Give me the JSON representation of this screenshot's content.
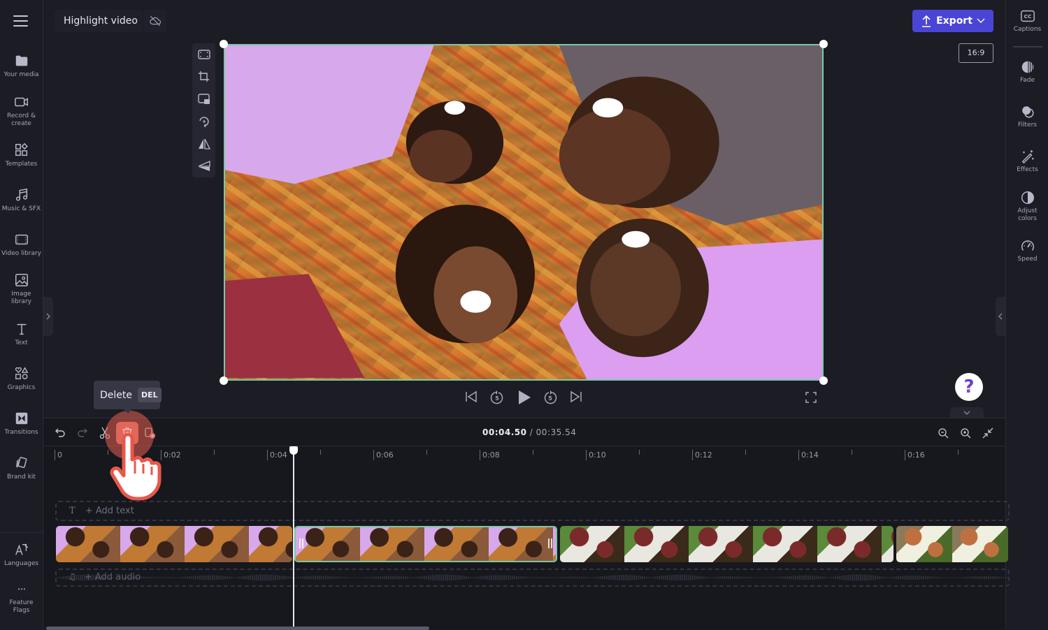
{
  "project": {
    "title": "Highlight video",
    "cloud_status_icon": "cloud-off-icon"
  },
  "left_rail": {
    "menu_icon": "hamburger-menu-icon",
    "items": [
      {
        "label": "Your media",
        "icon": "folder-icon"
      },
      {
        "label": "Record & create",
        "label_lines": [
          "Record &",
          "create"
        ],
        "icon": "video-camera-icon"
      },
      {
        "label": "Templates",
        "icon": "templates-icon"
      },
      {
        "label": "Music & SFX",
        "icon": "music-note-icon"
      },
      {
        "label": "Video library",
        "icon": "film-icon"
      },
      {
        "label": "Image library",
        "label_lines": [
          "Image",
          "library"
        ],
        "icon": "image-icon"
      },
      {
        "label": "Text",
        "icon": "text-icon"
      },
      {
        "label": "Graphics",
        "icon": "shapes-icon"
      },
      {
        "label": "Transitions",
        "icon": "transitions-icon"
      },
      {
        "label": "Brand kit",
        "icon": "brand-kit-icon"
      }
    ],
    "bottom_items": [
      {
        "label": "Languages",
        "icon": "languages-icon"
      },
      {
        "label": "Feature Flags",
        "label_lines": [
          "Feature",
          "Flags"
        ],
        "icon": "more-dots-icon"
      }
    ]
  },
  "header": {
    "export_label": "Export",
    "aspect_ratio": "16:9"
  },
  "preview_tools": [
    {
      "name": "fit-icon"
    },
    {
      "name": "crop-icon"
    },
    {
      "name": "picture-in-picture-icon"
    },
    {
      "name": "rotate-icon"
    },
    {
      "name": "flip-horizontal-icon"
    },
    {
      "name": "flip-vertical-icon"
    }
  ],
  "player": {
    "controls": [
      "skip-to-start-icon",
      "rewind-5-icon",
      "play-icon",
      "forward-5-icon",
      "skip-to-end-icon"
    ],
    "rewind_seconds": "5",
    "forward_seconds": "5",
    "fullscreen_icon": "fullscreen-icon",
    "help_label": "?"
  },
  "right_rail": {
    "items": [
      {
        "label": "Captions",
        "icon": "captions-icon"
      },
      {
        "label": "Fade",
        "icon": "fade-icon"
      },
      {
        "label": "Filters",
        "icon": "filters-icon"
      },
      {
        "label": "Effects",
        "icon": "magic-wand-icon"
      },
      {
        "label": "Adjust colors",
        "label_lines": [
          "Adjust",
          "colors"
        ],
        "icon": "contrast-icon"
      },
      {
        "label": "Speed",
        "icon": "speedometer-icon"
      }
    ]
  },
  "timeline": {
    "toolbar": [
      "undo-icon",
      "redo-icon",
      "split-scissors-icon",
      "delete-trash-icon",
      "duplicate-icon"
    ],
    "current_time": "00:04.50",
    "separator": "/",
    "total_time": "00:35.54",
    "zoom_controls": [
      "zoom-out-icon",
      "zoom-in-icon",
      "fit-timeline-icon"
    ],
    "ruler_labels": [
      "0",
      "0:02",
      "0:04",
      "0:06",
      "0:08",
      "0:10",
      "0:12",
      "0:14",
      "0:16"
    ],
    "text_track_label": "+ Add text",
    "audio_track_label": "+ Add audio",
    "clips": [
      {
        "name": "picnic-clip-1",
        "selected": false
      },
      {
        "name": "picnic-clip-2",
        "selected": true
      },
      {
        "name": "park-clip",
        "selected": false
      },
      {
        "name": "outdoor-clip",
        "selected": false
      }
    ]
  },
  "tooltip": {
    "label": "Delete",
    "shortcut": "DEL"
  },
  "colors": {
    "accent": "#4b45d6",
    "selection": "#78c9a8",
    "background": "#1c1c25",
    "timeline_bg": "#17171e",
    "hover_highlight": "#e75f50"
  }
}
